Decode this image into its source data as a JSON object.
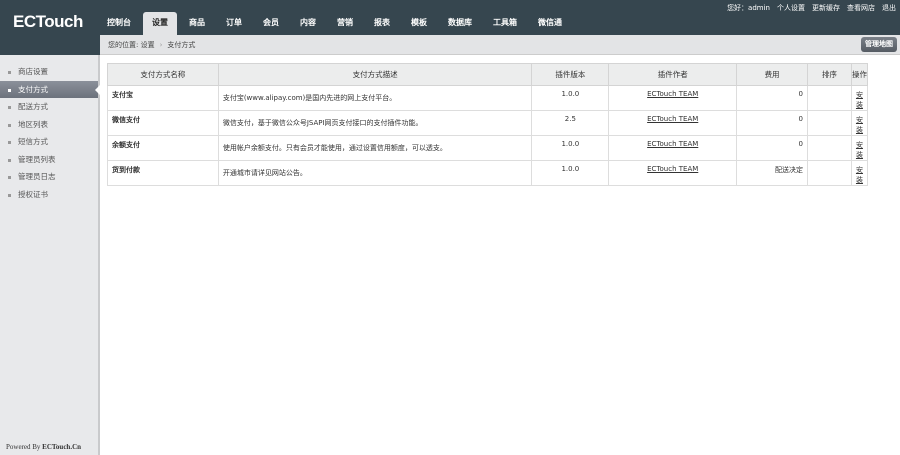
{
  "brand": "ECTouch",
  "nav": [
    "控制台",
    "设置",
    "商品",
    "订单",
    "会员",
    "内容",
    "营销",
    "报表",
    "模板",
    "数据库",
    "工具箱",
    "微信通"
  ],
  "nav_active": 1,
  "toplinks": [
    "您好：admin",
    "个人设置",
    "更新缓存",
    "查看网店",
    "退出"
  ],
  "breadcrumb": {
    "label": "您的位置:",
    "items": [
      "设置",
      "支付方式"
    ]
  },
  "map_button": "管理地图",
  "sidebar": {
    "items": [
      "商店设置",
      "支付方式",
      "配送方式",
      "地区列表",
      "短信方式",
      "管理员列表",
      "管理员日志",
      "授权证书"
    ],
    "active": 1
  },
  "table": {
    "headers": [
      "支付方式名称",
      "支付方式描述",
      "插件版本",
      "插件作者",
      "费用",
      "排序",
      "操作"
    ],
    "rows": [
      {
        "name": "支付宝",
        "desc": "支付宝(www.alipay.com)是国内先进的网上支付平台。",
        "version": "1.0.0",
        "author": "ECTouch TEAM",
        "fee": "0",
        "order": "",
        "action": "安装"
      },
      {
        "name": "微信支付",
        "desc": "微信支付，基于微信公众号JSAPI网页支付接口的支付插件功能。",
        "version": "2.5",
        "author": "ECTouch TEAM",
        "fee": "0",
        "order": "",
        "action": "安装"
      },
      {
        "name": "余额支付",
        "desc": "使用帐户余额支付。只有会员才能使用，通过设置信用额度，可以透支。",
        "version": "1.0.0",
        "author": "ECTouch TEAM",
        "fee": "0",
        "order": "",
        "action": "安装"
      },
      {
        "name": "货到付款",
        "desc": "开通城市请详见网站公告。",
        "version": "1.0.0",
        "author": "ECTouch TEAM",
        "fee": "配送决定",
        "order": "",
        "action": "安装"
      }
    ]
  },
  "footer": {
    "prefix": "Powered By ",
    "brand": "ECTouch.Cn"
  },
  "watermark": "https://www.huzhan.com/ishop11135"
}
